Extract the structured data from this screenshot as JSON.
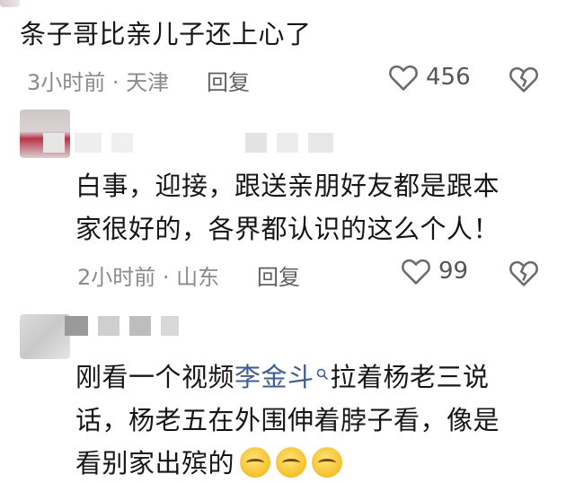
{
  "comments": [
    {
      "text": "条子哥比亲儿子还上心了",
      "meta": "3小时前 · 天津",
      "reply_label": "回复",
      "likes": "456"
    },
    {
      "lines": [
        "白事，迎接，跟送亲朋好友都是跟本",
        "家很好的，各界都认识的这么个人！"
      ],
      "meta": "2小时前 · 山东",
      "reply_label": "回复",
      "likes": "99"
    },
    {
      "line1_before": "刚看一个视频",
      "mention": "李金斗",
      "line1_after": "拉着杨老三说",
      "line2": "话，杨老五在外围伸着脖子看，像是",
      "line3": "看别家出殡的"
    }
  ],
  "colors": {
    "meta_gray": "#8a8a8a",
    "mention_blue": "#3f5d92",
    "icon_gray": "#6b6b6b"
  },
  "icons": {
    "like": "heart-outline-icon",
    "dislike": "broken-heart-icon",
    "mention_search": "search-icon",
    "emoji": "laughing-emoji-icon"
  }
}
